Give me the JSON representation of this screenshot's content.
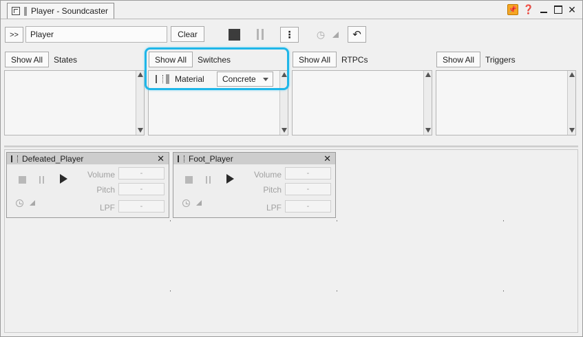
{
  "window": {
    "title": "Player - Soundcaster"
  },
  "toolbar": {
    "expand_label": ">>",
    "session_name": "Player",
    "clear_label": "Clear"
  },
  "panels": [
    {
      "show_all": "Show All",
      "label": "States"
    },
    {
      "show_all": "Show All",
      "label": "Switches",
      "items": [
        {
          "name": "Material",
          "value": "Concrete"
        }
      ]
    },
    {
      "show_all": "Show All",
      "label": "RTPCs"
    },
    {
      "show_all": "Show All",
      "label": "Triggers"
    }
  ],
  "cards": [
    {
      "name": "Defeated_Player",
      "volume_label": "Volume",
      "volume": "-",
      "pitch_label": "Pitch",
      "pitch": "-",
      "lpf_label": "LPF",
      "lpf": "-"
    },
    {
      "name": "Foot_Player",
      "volume_label": "Volume",
      "volume": "-",
      "pitch_label": "Pitch",
      "pitch": "-",
      "lpf_label": "LPF",
      "lpf": "-"
    }
  ],
  "colors": {
    "highlight": "#1fb6e8",
    "pin": "#f5a623"
  },
  "icons": [
    "soundcaster-icon",
    "pin-icon",
    "help-icon",
    "minimize-icon",
    "maximize-icon",
    "close-icon",
    "stop-icon",
    "pause-icon",
    "more-options-icon",
    "schedule-icon",
    "undo-icon",
    "play-icon"
  ]
}
